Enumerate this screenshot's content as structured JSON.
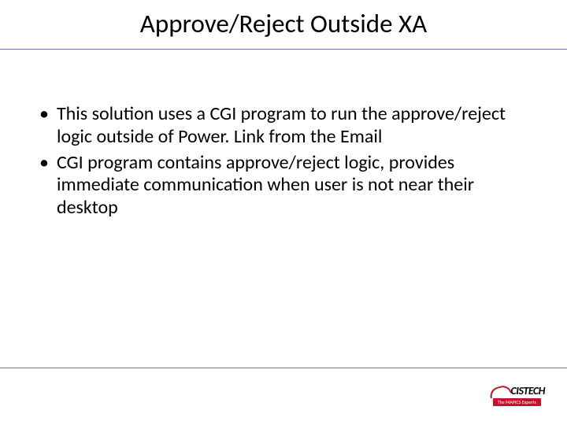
{
  "title": "Approve/Reject Outside XA",
  "bullets": [
    "This solution uses a CGI program to run the approve/reject logic outside of Power. Link from the Email",
    "CGI program contains approve/reject logic, provides immediate communication when user is not near their desktop"
  ],
  "logo": {
    "brand": "CISTECH",
    "tagline": "The MAPICS Experts"
  }
}
